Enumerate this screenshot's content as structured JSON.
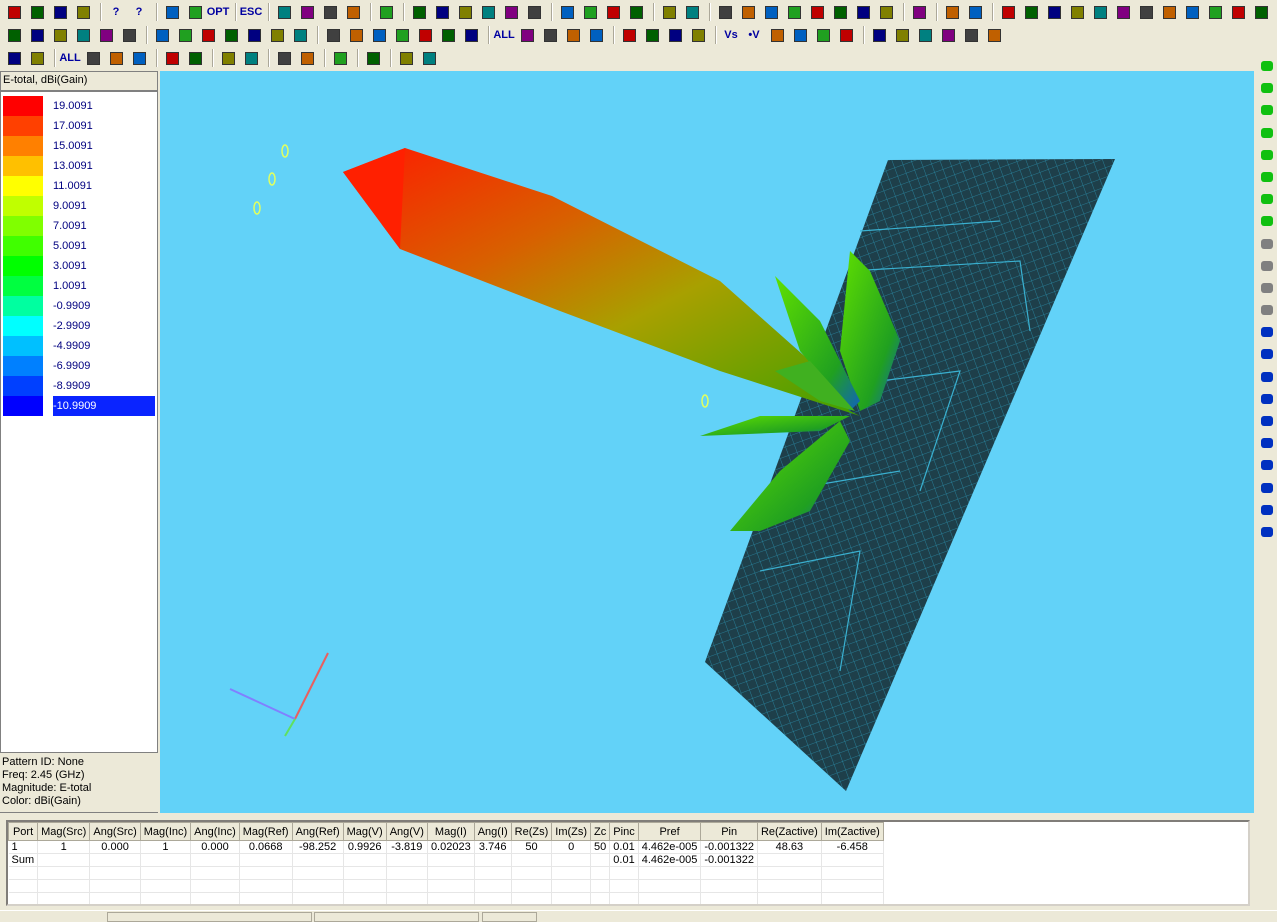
{
  "toolbar_rows": [
    [
      "new-file",
      "open-folder",
      "save",
      "print",
      "|",
      "help",
      "context-help",
      "|",
      "layers",
      "stack",
      "opt",
      "|",
      "esc",
      "|",
      "pencil",
      "select-arrow",
      "select-box",
      "select-box-2",
      "|",
      "eye",
      "|",
      "cut",
      "copy",
      "paste",
      "delete",
      "move",
      "camera",
      "|",
      "align-1",
      "align-2",
      "align-3",
      "align-4",
      "|",
      "pointer",
      "crop",
      "|",
      "line",
      "arc",
      "rect",
      "circle",
      "polyline",
      "polygon",
      "grid-dots",
      "grid-dots-2",
      "|",
      "cube",
      "|",
      "undo",
      "redo",
      "|",
      "block-1",
      "block-2",
      "block-3",
      "block-4",
      "block-5",
      "block-6",
      "block-7",
      "block-8",
      "block-9",
      "block-10",
      "block-11",
      "block-12",
      "block-13"
    ],
    [
      "port-select",
      "port-box",
      "port-1",
      "port-1b",
      "port-pair",
      "port-pair-2",
      "|",
      "mesh",
      "run",
      "sphere",
      "run-field",
      "run-field-2",
      "current",
      "pattern-window",
      "|",
      "sphere-view",
      "clapper",
      "bend",
      "rainbow",
      "wave",
      "heatmap",
      "chart",
      "|",
      "all",
      "zoom-win",
      "zoom-in",
      "zoom-out",
      "zoom-fit",
      "|",
      "arrow-left",
      "arrow-right",
      "arrow-down",
      "arrow-up",
      "|",
      "vs",
      "v",
      "s1",
      "s2",
      "s3",
      "s4",
      "|",
      "color-1",
      "color-2",
      "color-3",
      "color-4",
      "bar",
      "xy"
    ],
    [
      "save-disk",
      "dots-grid",
      "|",
      "all-zoom",
      "zoom-in-2",
      "zoom-out-2",
      "rotate",
      "|",
      "axes",
      "legend-bars",
      "|",
      "port-table",
      "angle",
      "|",
      "waves",
      "waves-2",
      "|",
      "gear",
      "|",
      "bulb",
      "|",
      "window-color",
      "paint"
    ]
  ],
  "toolbar_labels": {
    "opt": "OPT",
    "esc": "ESC",
    "all": "ALL",
    "all-zoom": "ALL",
    "vs": "Vs",
    "v": "•V",
    "help": "?",
    "context-help": "?"
  },
  "right_toolbar": [
    "half-circle-green",
    "tee",
    "wye",
    "stub",
    "bend-green",
    "ellipse",
    "ring",
    "arc-up",
    "cylinder",
    "pipe",
    "ball",
    "coil",
    "coil-2",
    "square-blue",
    "square-blue-2",
    "spiral",
    "ring-2",
    "ring-3",
    "via",
    "bridge",
    "slope",
    "cap-blue"
  ],
  "legend": {
    "title": "E-total, dBi(Gain)",
    "entries": [
      {
        "value": "19.0091",
        "color": "#ff0000"
      },
      {
        "value": "17.0091",
        "color": "#ff4000"
      },
      {
        "value": "15.0091",
        "color": "#ff8000"
      },
      {
        "value": "13.0091",
        "color": "#ffc000"
      },
      {
        "value": "11.0091",
        "color": "#ffff00"
      },
      {
        "value": "9.0091",
        "color": "#c0ff00"
      },
      {
        "value": "7.0091",
        "color": "#80ff00"
      },
      {
        "value": "5.0091",
        "color": "#40ff00"
      },
      {
        "value": "3.0091",
        "color": "#00ff00"
      },
      {
        "value": "1.0091",
        "color": "#00ff40"
      },
      {
        "value": "-0.9909",
        "color": "#00ffa0"
      },
      {
        "value": "-2.9909",
        "color": "#00ffff"
      },
      {
        "value": "-4.9909",
        "color": "#00c0ff"
      },
      {
        "value": "-6.9909",
        "color": "#0080ff"
      },
      {
        "value": "-8.9909",
        "color": "#0040ff"
      },
      {
        "value": "-10.9909",
        "color": "#0000ff"
      }
    ],
    "selected_index": 15
  },
  "info": {
    "pattern_id": "Pattern ID: None",
    "freq": "Freq: 2.45 (GHz)",
    "magnitude": "Magnitude: E-total",
    "color": "Color: dBi(Gain)"
  },
  "table": {
    "columns": [
      "Port",
      "Mag(Src)",
      "Ang(Src)",
      "Mag(Inc)",
      "Ang(Inc)",
      "Mag(Ref)",
      "Ang(Ref)",
      "Mag(V)",
      "Ang(V)",
      "Mag(I)",
      "Ang(I)",
      "Re(Zs)",
      "Im(Zs)",
      "Zc",
      "Pinc",
      "Pref",
      "Pin",
      "Re(Zactive)",
      "Im(Zactive)"
    ],
    "rows": [
      [
        "1",
        "1",
        "0.000",
        "1",
        "0.000",
        "0.0668",
        "-98.252",
        "0.9926",
        "-3.819",
        "0.02023",
        "3.746",
        "50",
        "0",
        "50",
        "0.01",
        "4.462e-005",
        "-0.001322",
        "48.63",
        "-6.458"
      ],
      [
        "Sum",
        "",
        "",
        "",
        "",
        "",
        "",
        "",
        "",
        "",
        "",
        "",
        "",
        "",
        "0.01",
        "4.462e-005",
        "-0.001322",
        "",
        ""
      ],
      [
        "",
        "",
        "",
        "",
        "",
        "",
        "",
        "",
        "",
        "",
        "",
        "",
        "",
        "",
        "",
        "",
        "",
        "",
        ""
      ],
      [
        "",
        "",
        "",
        "",
        "",
        "",
        "",
        "",
        "",
        "",
        "",
        "",
        "",
        "",
        "",
        "",
        "",
        "",
        ""
      ],
      [
        "",
        "",
        "",
        "",
        "",
        "",
        "",
        "",
        "",
        "",
        "",
        "",
        "",
        "",
        "",
        "",
        "",
        "",
        ""
      ]
    ]
  }
}
